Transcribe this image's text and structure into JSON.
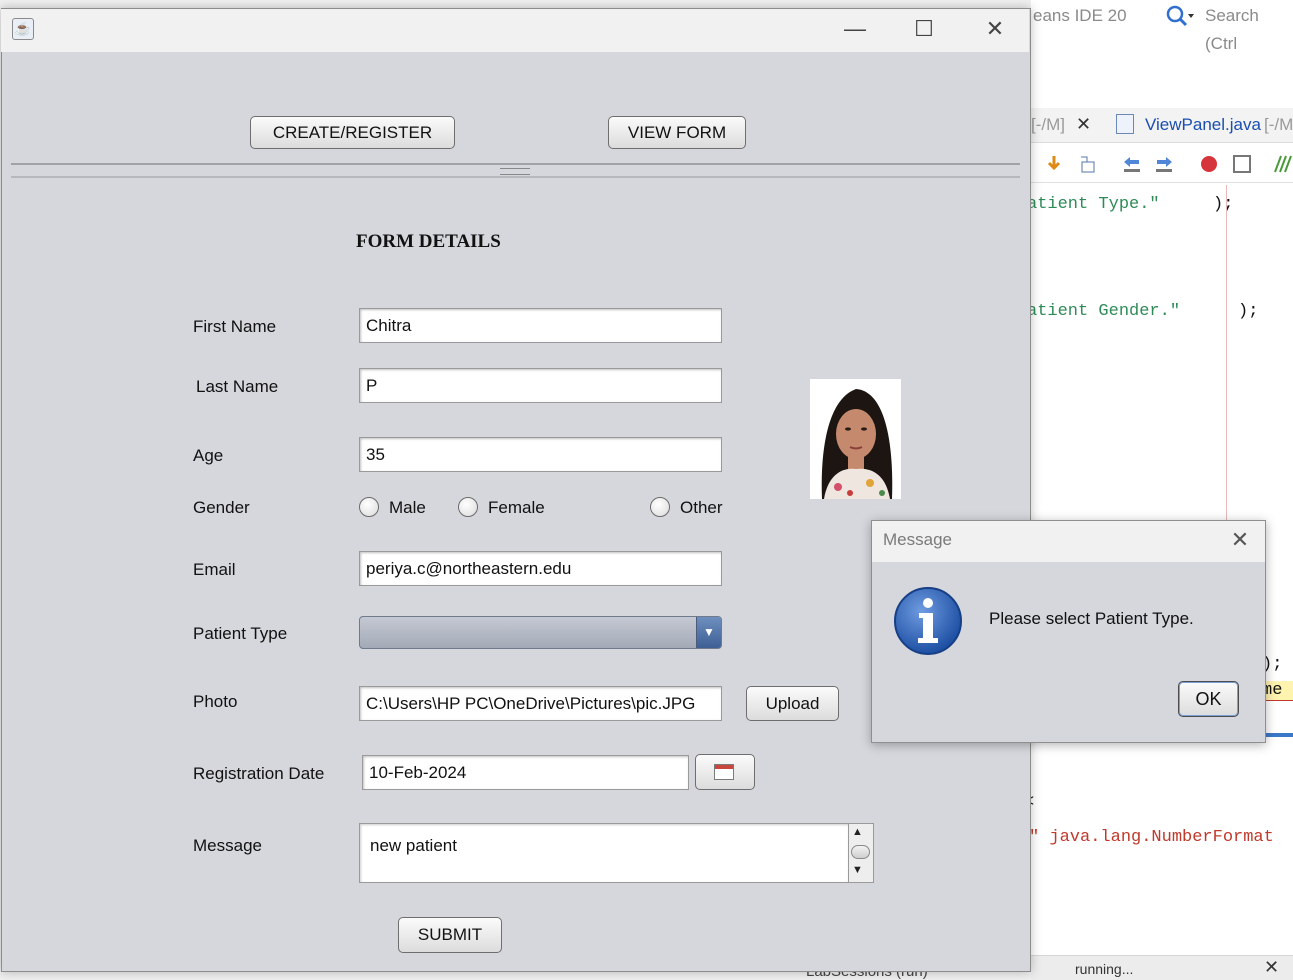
{
  "ide": {
    "title_fragment": "eans IDE 20",
    "search_placeholder": "Search (Ctrl",
    "tab1_fragment": "[-/M]",
    "tab2_name": "ViewPanel.java",
    "tab2_path": "[-/M",
    "code_line1": "atient Type.\"",
    "code_line1_end": ");",
    "code_line2": "atient Gender.\"",
    "code_line2_end": ");",
    "code_line3": ");",
    "code_line4": "me (",
    "output_marker": "<",
    "output_line": "\" java.lang.NumberFormat",
    "status_running": "running...",
    "taskbar_label": "LabSessions (run)"
  },
  "window": {
    "min_glyph": "—",
    "max_glyph": "☐",
    "close_glyph": "✕"
  },
  "toolbar": {
    "create_register_label": "CREATE/REGISTER",
    "view_form_label": "VIEW FORM"
  },
  "form": {
    "heading": "FORM DETAILS",
    "first_name_label": "First Name",
    "first_name_value": "Chitra",
    "last_name_label": "Last Name",
    "last_name_value": "P",
    "age_label": "Age",
    "age_value": "35",
    "gender_label": "Gender",
    "gender_options": [
      "Male",
      "Female",
      "Other"
    ],
    "email_label": "Email",
    "email_value": "periya.c@northeastern.edu",
    "patient_type_label": "Patient Type",
    "patient_type_value": "",
    "photo_label": "Photo",
    "photo_path": "C:\\Users\\HP PC\\OneDrive\\Pictures\\pic.JPG",
    "upload_label": "Upload",
    "registration_date_label": "Registration Date",
    "registration_date_value": "10-Feb-2024",
    "message_label": "Message",
    "message_value": "new patient",
    "submit_label": "SUBMIT"
  },
  "dialog": {
    "title": "Message",
    "message": "Please select Patient Type.",
    "ok_label": "OK",
    "close_glyph": "✕",
    "icon": "info-icon"
  }
}
